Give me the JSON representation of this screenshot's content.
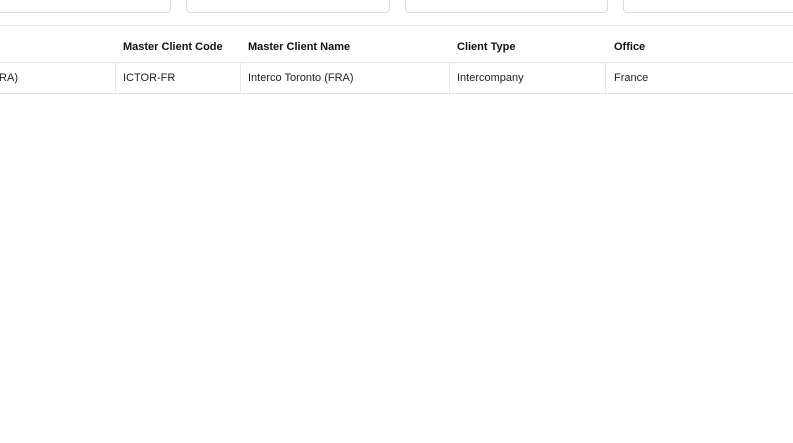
{
  "table": {
    "columns": [
      {
        "key": "name_partial",
        "label": ""
      },
      {
        "key": "master_client_code",
        "label": "Master Client Code"
      },
      {
        "key": "master_client_name",
        "label": "Master Client Name"
      },
      {
        "key": "client_type",
        "label": "Client Type"
      },
      {
        "key": "office",
        "label": "Office"
      }
    ],
    "rows": [
      {
        "name_partial": "Interco Toronto (FRA)",
        "master_client_code": "ICTOR-FR",
        "master_client_name": "Interco Toronto (FRA)",
        "client_type": "Intercompany",
        "office": "France"
      }
    ]
  }
}
